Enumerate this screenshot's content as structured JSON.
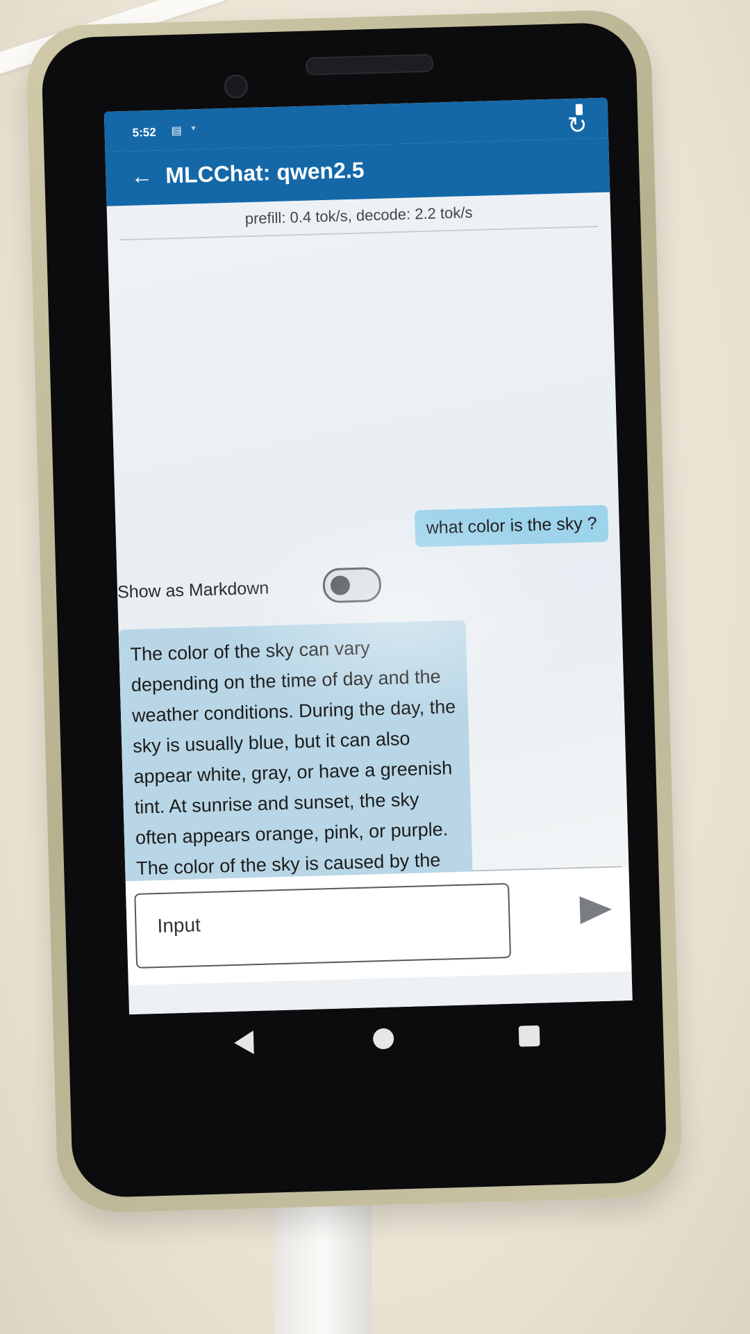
{
  "status_bar": {
    "time": "5:52",
    "sim_icon": "sim-icon",
    "wifi_icon": "wifi-icon",
    "battery_icon": "battery-icon"
  },
  "app_bar": {
    "back_icon": "arrow-left-icon",
    "title": "MLCChat: qwen2.5",
    "reset_icon": "reset-icon",
    "color": "#1468a8"
  },
  "stats": {
    "text": "prefill: 0.4 tok/s, decode: 2.2 tok/s"
  },
  "chat": {
    "messages": [
      {
        "role": "user",
        "text": "what color is the sky ?"
      },
      {
        "role": "bot",
        "text": "The color of the sky can vary depending on the time of day and the weather conditions. During the day, the sky is usually blue, but it can also appear white, gray, or have a greenish tint. At sunrise and sunset, the sky often appears orange, pink, or purple. The color of the sky is caused by the scattering of light from the sun."
      }
    ],
    "markdown_toggle": {
      "label": "Show as Markdown",
      "checked": false
    }
  },
  "input": {
    "placeholder": "Input",
    "send_icon": "send-icon"
  },
  "nav_bar": {
    "back_icon": "nav-back-icon",
    "home_icon": "nav-home-icon",
    "recents_icon": "nav-recents-icon"
  }
}
